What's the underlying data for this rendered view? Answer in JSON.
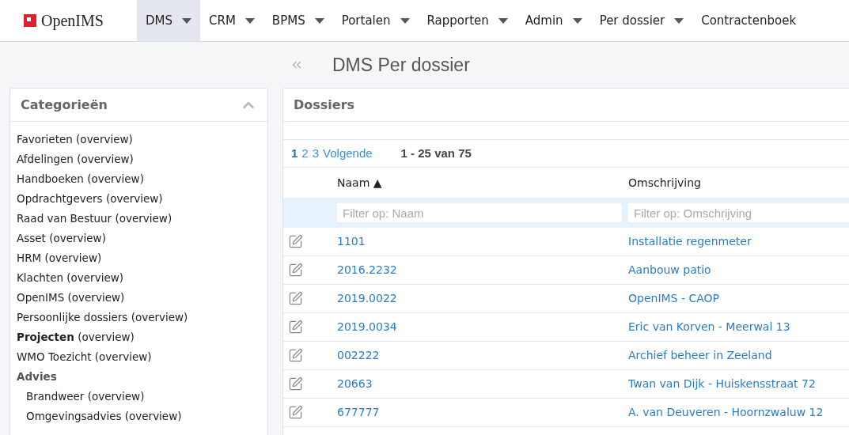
{
  "brand": {
    "name": "OpenIMS"
  },
  "nav": [
    {
      "label": "DMS",
      "dropdown": true,
      "selected": true
    },
    {
      "label": "CRM",
      "dropdown": true,
      "selected": false
    },
    {
      "label": "BPMS",
      "dropdown": true,
      "selected": false
    },
    {
      "label": "Portalen",
      "dropdown": true,
      "selected": false
    },
    {
      "label": "Rapporten",
      "dropdown": true,
      "selected": false
    },
    {
      "label": "Admin",
      "dropdown": true,
      "selected": false
    },
    {
      "label": "Per dossier",
      "dropdown": true,
      "selected": false
    },
    {
      "label": "Contractenboek",
      "dropdown": false,
      "selected": false
    }
  ],
  "page_title": "DMS Per dossier",
  "categories": {
    "title": "Categorieën",
    "expanded": true,
    "items": [
      {
        "kind": "link",
        "label": "Favorieten (overview)"
      },
      {
        "kind": "link",
        "label": "Afdelingen (overview)"
      },
      {
        "kind": "link",
        "label": "Handboeken (overview)"
      },
      {
        "kind": "link",
        "label": "Opdrachtgevers (overview)"
      },
      {
        "kind": "link",
        "label": "Raad van Bestuur (overview)"
      },
      {
        "kind": "link",
        "label": "Asset (overview)"
      },
      {
        "kind": "link",
        "label": "HRM (overview)"
      },
      {
        "kind": "link",
        "label": "Klachten (overview)"
      },
      {
        "kind": "link",
        "label": "OpenIMS (overview)"
      },
      {
        "kind": "link",
        "label": "Persoonlijke dossiers (overview)"
      },
      {
        "kind": "link",
        "label": "**Projecten** (overview)"
      },
      {
        "kind": "link",
        "label": "WMO Toezicht (overview)"
      },
      {
        "kind": "group",
        "label": "Advies",
        "children": [
          {
            "kind": "link",
            "label": "Brandweer (overview)"
          },
          {
            "kind": "link",
            "label": "Omgevingsadvies (overview)"
          }
        ]
      }
    ]
  },
  "dossiers": {
    "title": "Dossiers",
    "pagination": {
      "pages": [
        {
          "label": "1",
          "selected": true
        },
        {
          "label": "2",
          "selected": false
        },
        {
          "label": "3",
          "selected": false
        }
      ],
      "next": "Volgende",
      "range": "1 - 25 van 75"
    },
    "columns": [
      {
        "label": "Naam ▲",
        "placeholder": "Filter op: Naam"
      },
      {
        "label": "Omschrijving",
        "placeholder": "Filter op: Omschrijving"
      }
    ],
    "rows": [
      [
        "1101",
        "Installatie regenmeter"
      ],
      [
        "2016.2232",
        "Aanbouw patio"
      ],
      [
        "2019.0022",
        "OpenIMS - CAOP"
      ],
      [
        "2019.0034",
        "Eric van Korven - Meerwal 13"
      ],
      [
        "002222",
        "Archief beheer in Zeeland"
      ],
      [
        "20663",
        "Twan van Dijk - Huiskensstraat 72"
      ],
      [
        "677777",
        "A. van Deuveren - Hoornzwaluw 12"
      ]
    ]
  }
}
